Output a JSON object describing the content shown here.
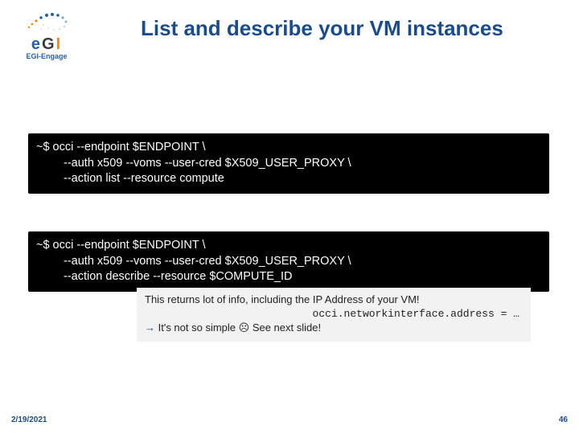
{
  "logo": {
    "main_e": "e",
    "main_g": "G",
    "main_i": "I",
    "sub": "EGI-Engage"
  },
  "title": "List and describe your VM instances",
  "code1": {
    "l1": "~$ occi --endpoint $ENDPOINT \\",
    "l2": "--auth x509 --voms --user-cred $X509_USER_PROXY \\",
    "l3": "--action list --resource compute"
  },
  "code2": {
    "l1": "~$ occi --endpoint $ENDPOINT \\",
    "l2": "--auth x509 --voms --user-cred $X509_USER_PROXY \\",
    "l3": "--action describe --resource $COMPUTE_ID"
  },
  "note": {
    "line1": "This returns lot of info, including the IP Address of your VM!",
    "mono": "occi.networkinterface.address = …",
    "arrow": "→",
    "line3a": " It's not so simple ",
    "sad": "☹",
    "line3b": " See next slide!"
  },
  "footer": {
    "date": "2/19/2021",
    "page": "46"
  }
}
